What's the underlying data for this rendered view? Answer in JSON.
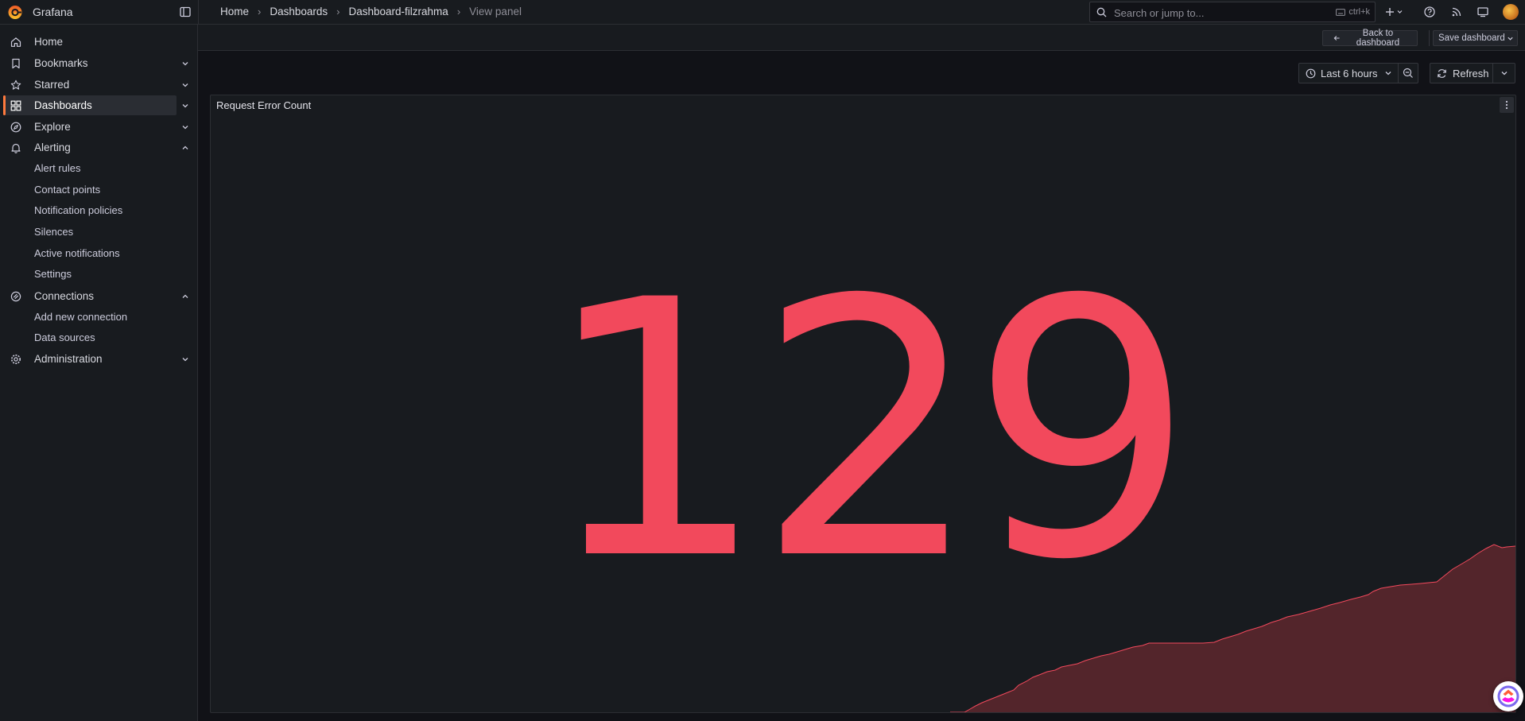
{
  "app": {
    "title": "Grafana"
  },
  "breadcrumb": [
    "Home",
    "Dashboards",
    "Dashboard-filzrahma",
    "View panel"
  ],
  "search": {
    "placeholder": "Search or jump to...",
    "shortcut": "ctrl+k"
  },
  "sidebar": {
    "items": [
      {
        "label": "Home",
        "icon": "home-icon"
      },
      {
        "label": "Bookmarks",
        "icon": "bookmark-icon",
        "chevron": "down"
      },
      {
        "label": "Starred",
        "icon": "star-icon",
        "chevron": "down"
      },
      {
        "label": "Dashboards",
        "icon": "apps-icon",
        "chevron": "down",
        "active": true
      },
      {
        "label": "Explore",
        "icon": "compass-icon",
        "chevron": "down"
      },
      {
        "label": "Alerting",
        "icon": "bell-icon",
        "chevron": "up"
      },
      {
        "label": "Connections",
        "icon": "connections-icon",
        "chevron": "up"
      },
      {
        "label": "Administration",
        "icon": "cog-icon",
        "chevron": "down"
      }
    ],
    "alerting_children": [
      "Alert rules",
      "Contact points",
      "Notification policies",
      "Silences",
      "Active notifications",
      "Settings"
    ],
    "connections_children": [
      "Add new connection",
      "Data sources"
    ]
  },
  "toolbar": {
    "back_label": "Back to dashboard",
    "save_label": "Save dashboard"
  },
  "time_picker": {
    "label": "Last 6 hours"
  },
  "refresh": {
    "label": "Refresh"
  },
  "panel": {
    "title": "Request Error Count",
    "value": "129",
    "value_color": "#f2495c",
    "sparkline_fill": "#5a272c"
  },
  "colors": {
    "accent": "#ff7a3d",
    "background": "#111217",
    "panel": "#181b1f"
  }
}
